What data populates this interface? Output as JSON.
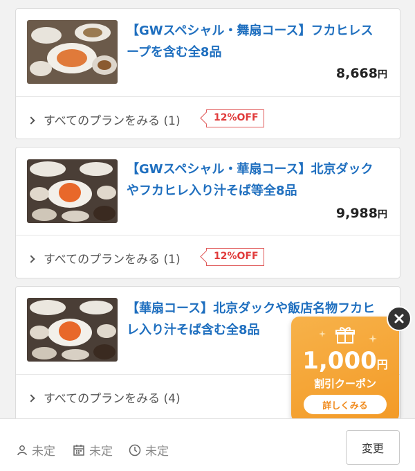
{
  "plans": [
    {
      "title": "【GWスペシャル・舞扇コース】フカヒレスープを含む全8品",
      "price": "8,668",
      "yen": "円",
      "see_all": "すべてのプランをみる (1)",
      "badge": "12%OFF"
    },
    {
      "title": "【GWスペシャル・華扇コース】北京ダックやフカヒレ入り汁そば等全8品",
      "price": "9,988",
      "yen": "円",
      "see_all": "すべてのプランをみる (1)",
      "badge": "12%OFF"
    },
    {
      "title": "【華扇コース】北京ダックや飯店名物フカヒレ入り汁そば含む全8品",
      "see_all": "すべてのプランをみる (4)"
    }
  ],
  "bottom_bar": {
    "people": "未定",
    "date": "未定",
    "time": "未定",
    "change_label": "変更"
  },
  "coupon": {
    "amount": "1,000",
    "yen": "円",
    "label": "割引クーポン",
    "detail_label": "詳しくみる"
  },
  "colors": {
    "title": "#1f6fbf",
    "badge": "#e03a3a",
    "coupon": "#f39a26"
  }
}
